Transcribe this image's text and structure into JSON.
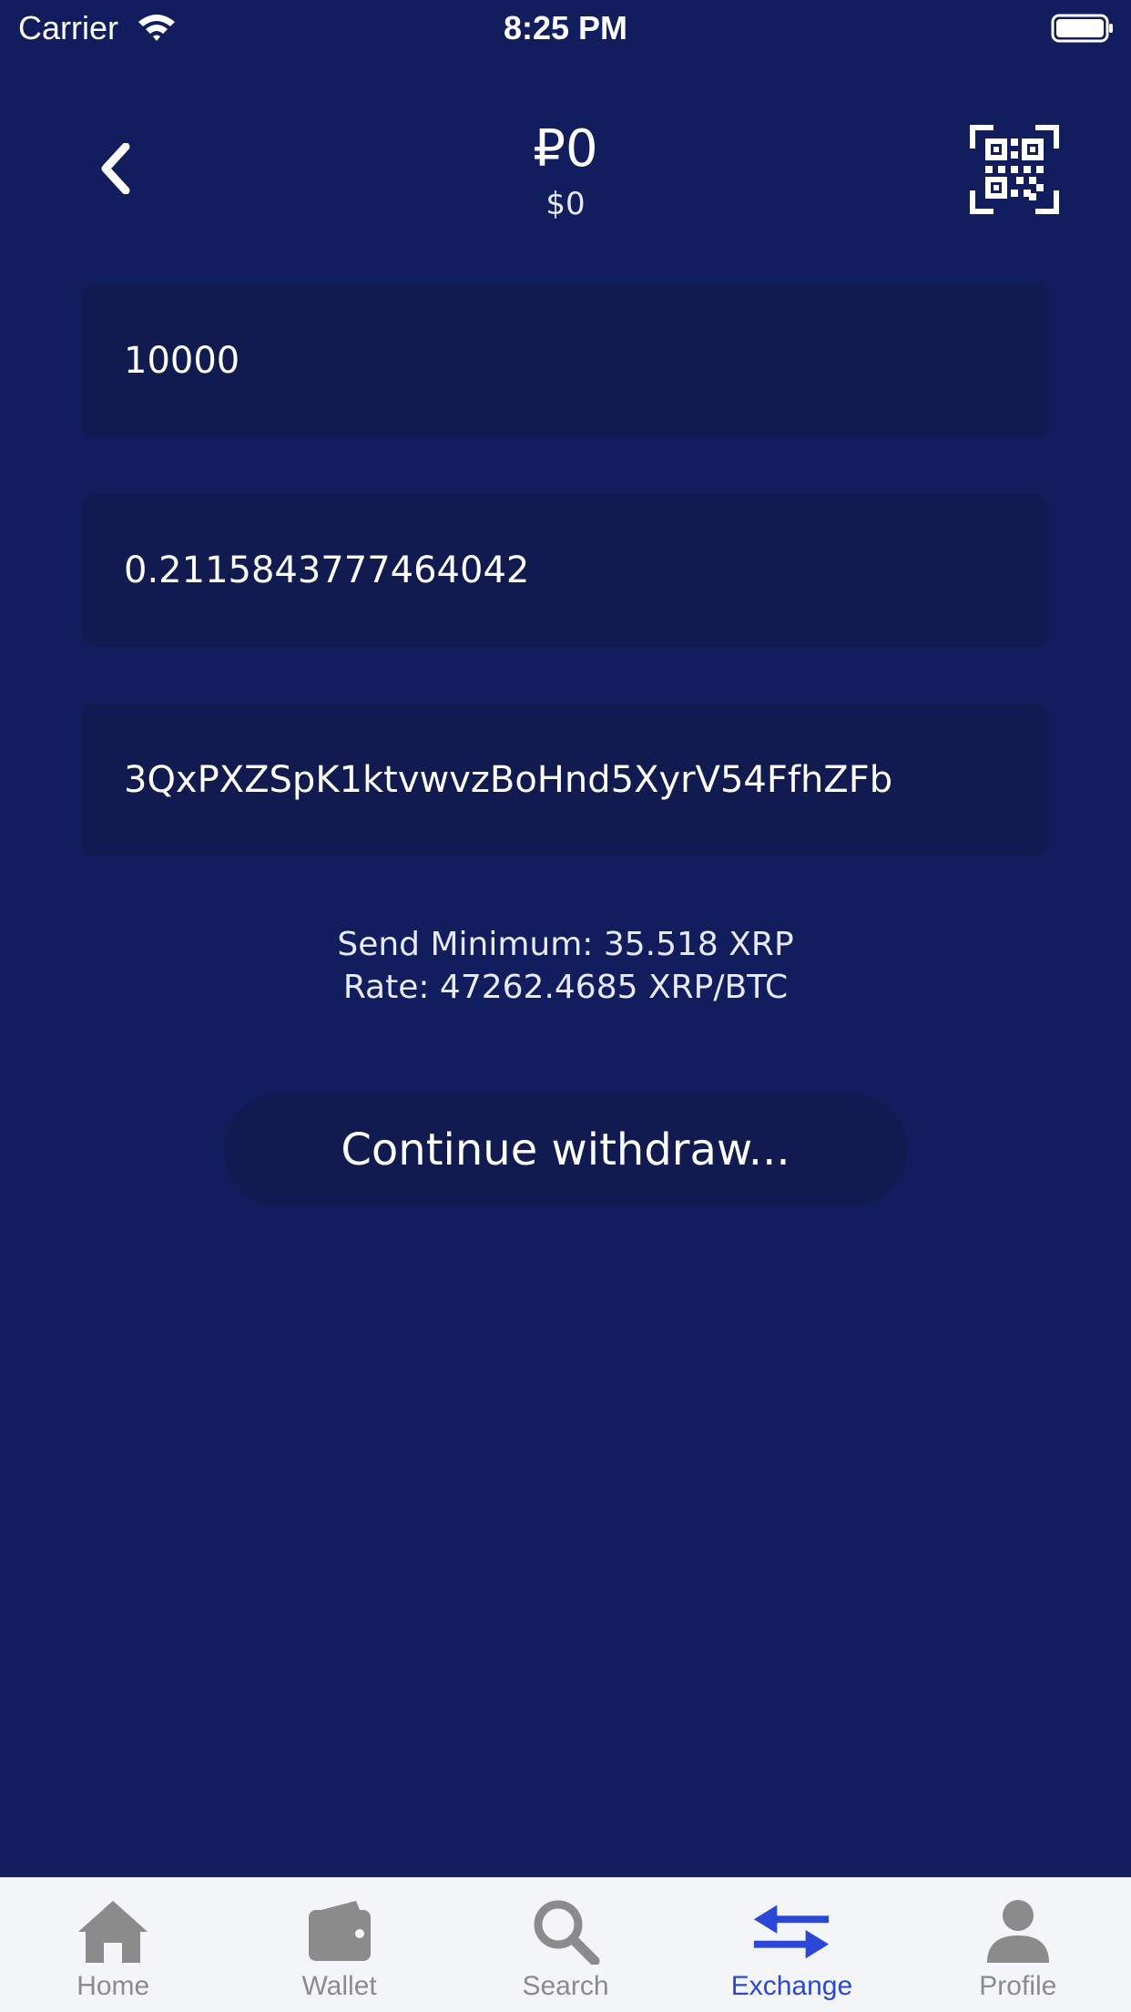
{
  "status_bar": {
    "carrier": "Carrier",
    "time": "8:25 PM"
  },
  "header": {
    "balance": "₽0",
    "balance_usd": "$0",
    "back_icon": "chevron-left-icon",
    "qr_icon": "qr-scan-icon"
  },
  "form": {
    "amount_value": "10000",
    "converted_value": "0.2115843777464042",
    "address_value": "3QxPXZSpK1ktvwvzBoHnd5XyrV54FfhZFb",
    "send_minimum": "Send Minimum: 35.518 XRP",
    "rate": "Rate: 47262.4685 XRP/BTC",
    "continue_label": "Continue withdraw..."
  },
  "tab_bar": {
    "tabs": [
      {
        "label": "Home",
        "icon": "home-icon",
        "active": false
      },
      {
        "label": "Wallet",
        "icon": "wallet-icon",
        "active": false
      },
      {
        "label": "Search",
        "icon": "search-icon",
        "active": false
      },
      {
        "label": "Exchange",
        "icon": "exchange-icon",
        "active": true
      },
      {
        "label": "Profile",
        "icon": "profile-icon",
        "active": false
      }
    ]
  },
  "colors": {
    "background": "#121d5e",
    "field_background": "#111b4f",
    "tab_active": "#2a48d8",
    "tab_inactive": "#8b8b8b",
    "tab_bar_background": "#f4f5f8"
  }
}
